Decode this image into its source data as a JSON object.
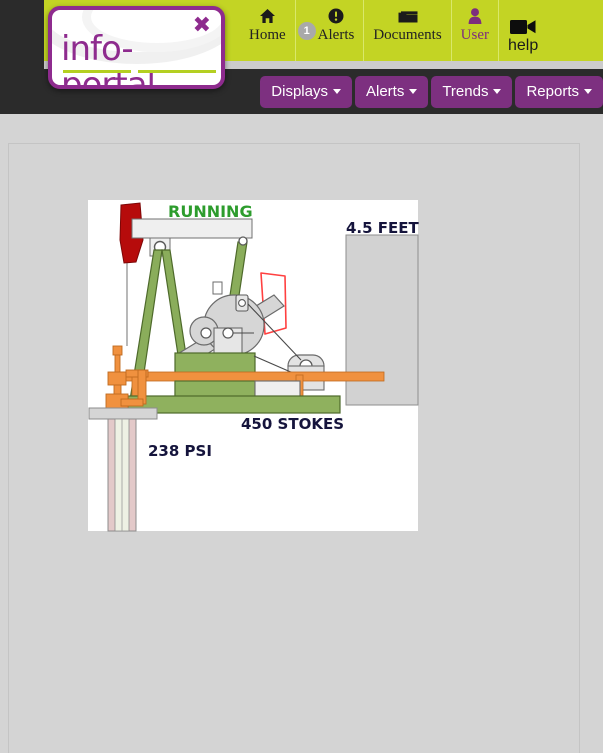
{
  "brand": {
    "logo_text": "info-portal",
    "logo_mark": "✖",
    "accent_purple": "#8e2b8e",
    "accent_green": "#c3d424"
  },
  "topnav": {
    "items": [
      {
        "label": "Home",
        "icon": "home-icon",
        "badge": null
      },
      {
        "label": "Alerts",
        "icon": "alert-icon",
        "badge": "1"
      },
      {
        "label": "Documents",
        "icon": "folder-icon",
        "badge": null
      },
      {
        "label": "User",
        "icon": "user-icon",
        "badge": null
      },
      {
        "label": "help",
        "icon": "video-camera-icon",
        "badge": null
      }
    ]
  },
  "mainnav": {
    "items": [
      {
        "label": "Displays"
      },
      {
        "label": "Alerts"
      },
      {
        "label": "Trends"
      },
      {
        "label": "Reports"
      }
    ]
  },
  "diagram": {
    "name": "pump-jack-schematic",
    "status_label": "RUNNING",
    "status_color": "#2d9c2d",
    "tank_level_label": "4.5 FEET",
    "strokes_label": "450 STOKES",
    "pressure_label": "238 PSI",
    "colors": {
      "horsehead": "#b60b0b",
      "beam": "#efefef",
      "frame_green": "#8aad5b",
      "base_green": "#8fb15e",
      "wellhead_orange": "#f0913f",
      "walkway_orange": "#f0913f",
      "tank_gray": "#d2d2d2",
      "counterweight_outline": "#ff4040",
      "crank_gray": "#d6d6d6"
    }
  }
}
